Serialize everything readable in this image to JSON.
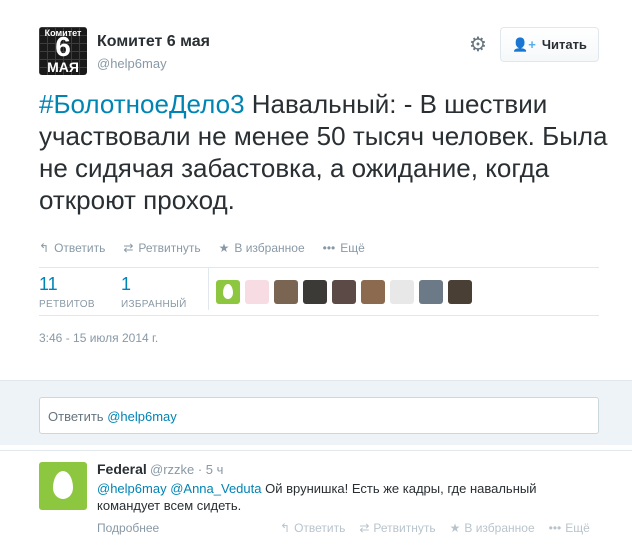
{
  "tweet": {
    "avatar": {
      "top_text": "Комитет",
      "number": "6",
      "bottom_text": "МАЯ"
    },
    "author_name": "Комитет 6 мая",
    "author_handle": "@help6may",
    "follow_label": "Читать",
    "text_hashtag": "#БолотноеДело3",
    "text_body": " Навальный: - В шествии участвовали не менее 50 тысяч человек. Была не сидячая забастовка, а ожидание, когда откроют проход.",
    "actions": [
      {
        "icon": "reply-icon",
        "glyph": "↰",
        "label": "Ответить"
      },
      {
        "icon": "retweet-icon",
        "glyph": "⇄",
        "label": "Ретвитнуть"
      },
      {
        "icon": "star-icon",
        "glyph": "★",
        "label": "В избранное"
      },
      {
        "icon": "more-icon",
        "glyph": "•••",
        "label": "Ещё"
      }
    ],
    "stats": {
      "retweets_count": "11",
      "retweets_label": "РЕТВИТОВ",
      "favorites_count": "1",
      "favorites_label": "ИЗБРАННЫЙ"
    },
    "favoriter_colors": [
      "#8dc63f",
      "#f7dde3",
      "#7a6552",
      "#3c3a36",
      "#5b4a45",
      "#8b6a4f",
      "#e8e8e8",
      "#6c7a88",
      "#4a3f35"
    ],
    "timestamp": "3:46 - 15 июля 2014 г."
  },
  "reply_box": {
    "prefix": "Ответить ",
    "mention": "@help6may"
  },
  "reply": {
    "name": "Federal",
    "handle": "@rzzke · 5 ч",
    "mention1": "@help6may",
    "mention2": "@Anna_Veduta",
    "text": "  Ой врунишка! Есть же кадры, где навальный командует всем сидеть.",
    "more_label": "Подробнее",
    "actions": [
      {
        "icon": "reply-icon",
        "glyph": "↰",
        "label": "Ответить"
      },
      {
        "icon": "retweet-icon",
        "glyph": "⇄",
        "label": "Ретвитнуть"
      },
      {
        "icon": "star-icon",
        "glyph": "★",
        "label": "В избранное"
      },
      {
        "icon": "more-icon",
        "glyph": "•••",
        "label": "Ещё"
      }
    ]
  },
  "colors": {
    "link": "#0084b4",
    "muted": "#8899a6",
    "text": "#292f33",
    "reply_bg": "#edf3f7",
    "egg_green": "#8dc63f"
  }
}
